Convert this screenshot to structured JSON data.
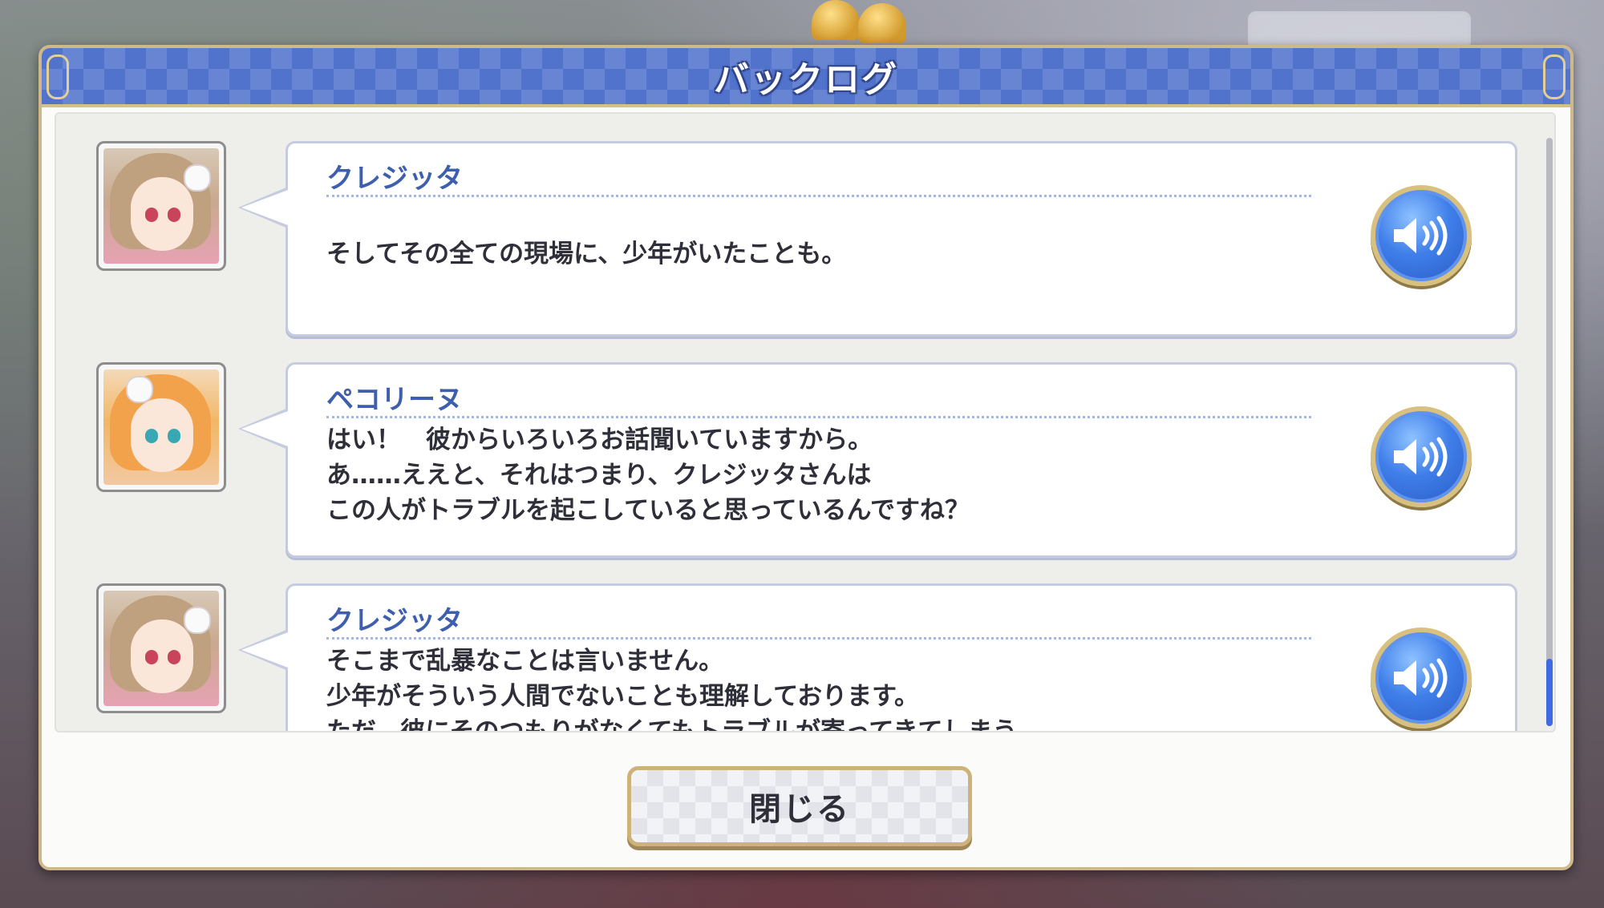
{
  "dialog": {
    "title": "バックログ",
    "close_label": "閉じる"
  },
  "log": {
    "entries": [
      {
        "speaker": "クレジッタ",
        "portrait": "kurejitta-portrait",
        "lines": [
          "そしてその全ての現場に、少年がいたことも。"
        ]
      },
      {
        "speaker": "ペコリーヌ",
        "portrait": "pecorine-portrait",
        "lines": [
          "はい！　彼からいろいろお話聞いていますから。",
          "あ……ええと、それはつまり、クレジッタさんは",
          "この人がトラブルを起こしていると思っているんですね？"
        ]
      },
      {
        "speaker": "クレジッタ",
        "portrait": "kurejitta-portrait",
        "lines": [
          "そこまで乱暴なことは言いません。",
          "少年がそういう人間でないことも理解しております。",
          "ただ、彼にそのつもりがなくてもトラブルが寄ってきてしまう……"
        ]
      }
    ],
    "voice_icon": "speaker-volume-icon"
  },
  "colors": {
    "header_blue": "#5173cc",
    "name_blue": "#3e5fae",
    "gold_border": "#cfb98a",
    "voice_button_blue": "#3f7ee9",
    "scroll_thumb": "#3f6ae0"
  }
}
